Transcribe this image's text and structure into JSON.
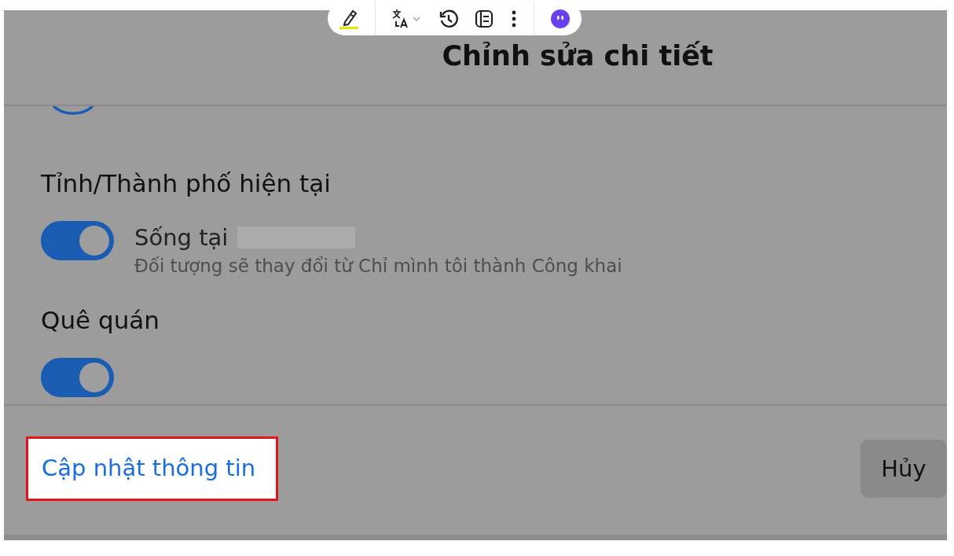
{
  "toolbar": {
    "tools": [
      {
        "kind": "highlighter"
      },
      {
        "kind": "translate"
      },
      {
        "kind": "history"
      },
      {
        "kind": "reader"
      },
      {
        "kind": "more"
      },
      {
        "kind": "assistant"
      }
    ]
  },
  "dialog": {
    "title": "Chỉnh sửa chi tiết",
    "sections": [
      {
        "heading": "Tỉnh/Thành phố hiện tại",
        "toggle": {
          "on": true,
          "label": "Sống tại",
          "note": "Đối tượng sẽ thay đổi từ Chỉ mình tôi thành Công khai"
        }
      },
      {
        "heading": "Quê quán",
        "toggle": {
          "on": true
        }
      }
    ],
    "footer": {
      "link": "Cập nhật thông tin",
      "cancel": "Hủy"
    }
  }
}
